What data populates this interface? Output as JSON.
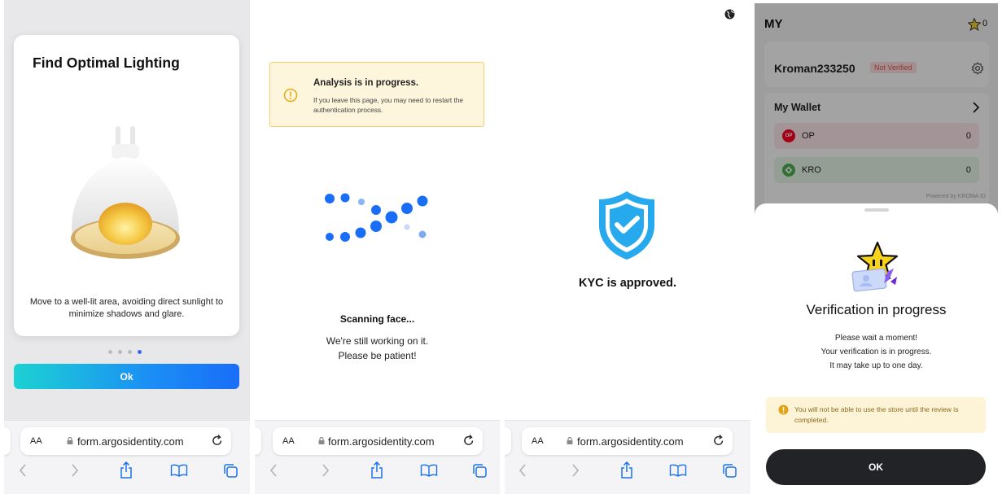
{
  "panel1": {
    "card_title": "Find Optimal Lighting",
    "card_description": "Move to a well-lit area, avoiding direct sunlight to minimize shadows and glare.",
    "pager": {
      "total": 4,
      "active": 4
    },
    "ok_label": "Ok",
    "gradient": [
      "#1cd2d2",
      "#1a6df7"
    ],
    "illustration": "ceiling-lamp"
  },
  "panel2": {
    "alert": {
      "title": "Analysis is in progress.",
      "body": "If you leave this page, you may need to restart the authentication process.",
      "icon": "info-circle-icon",
      "color": "#f2cf71"
    },
    "scan_title": "Scanning face...",
    "scan_line1": "We're still working on it.",
    "scan_line2": "Please be patient!",
    "accent": "#1a6df7"
  },
  "panel3": {
    "status": "KYC is approved.",
    "icon": "shield-check-icon",
    "accent": "#27a9ee"
  },
  "browser": {
    "aa_label": "AA",
    "url": "form.argosidentity.com",
    "toolbar": [
      "back-icon",
      "forward-icon",
      "share-icon",
      "bookmarks-icon",
      "tabs-icon"
    ]
  },
  "panel4": {
    "app_title": "MY",
    "coin_count": "0",
    "username": "Kroman233250",
    "verification_badge": "Not Verified",
    "wallet_title": "My Wallet",
    "tokens": [
      {
        "symbol": "OP",
        "icon_text": "OP",
        "value": "0",
        "color": "#ff0420",
        "row_color": "#fde8ec"
      },
      {
        "symbol": "KRO",
        "icon_text": "",
        "value": "0",
        "color": "#4caf50",
        "row_color": "#e9f8ea"
      }
    ],
    "powered_by": "Powered by KROMA ID",
    "sheet": {
      "title": "Verification in progress",
      "line1": "Please wait a moment!",
      "line2": "Your verification is in progress.",
      "line3": "It may take up to one day.",
      "warning": "You will not be able to use the store until the review is completed.",
      "ok_label": "OK"
    }
  }
}
